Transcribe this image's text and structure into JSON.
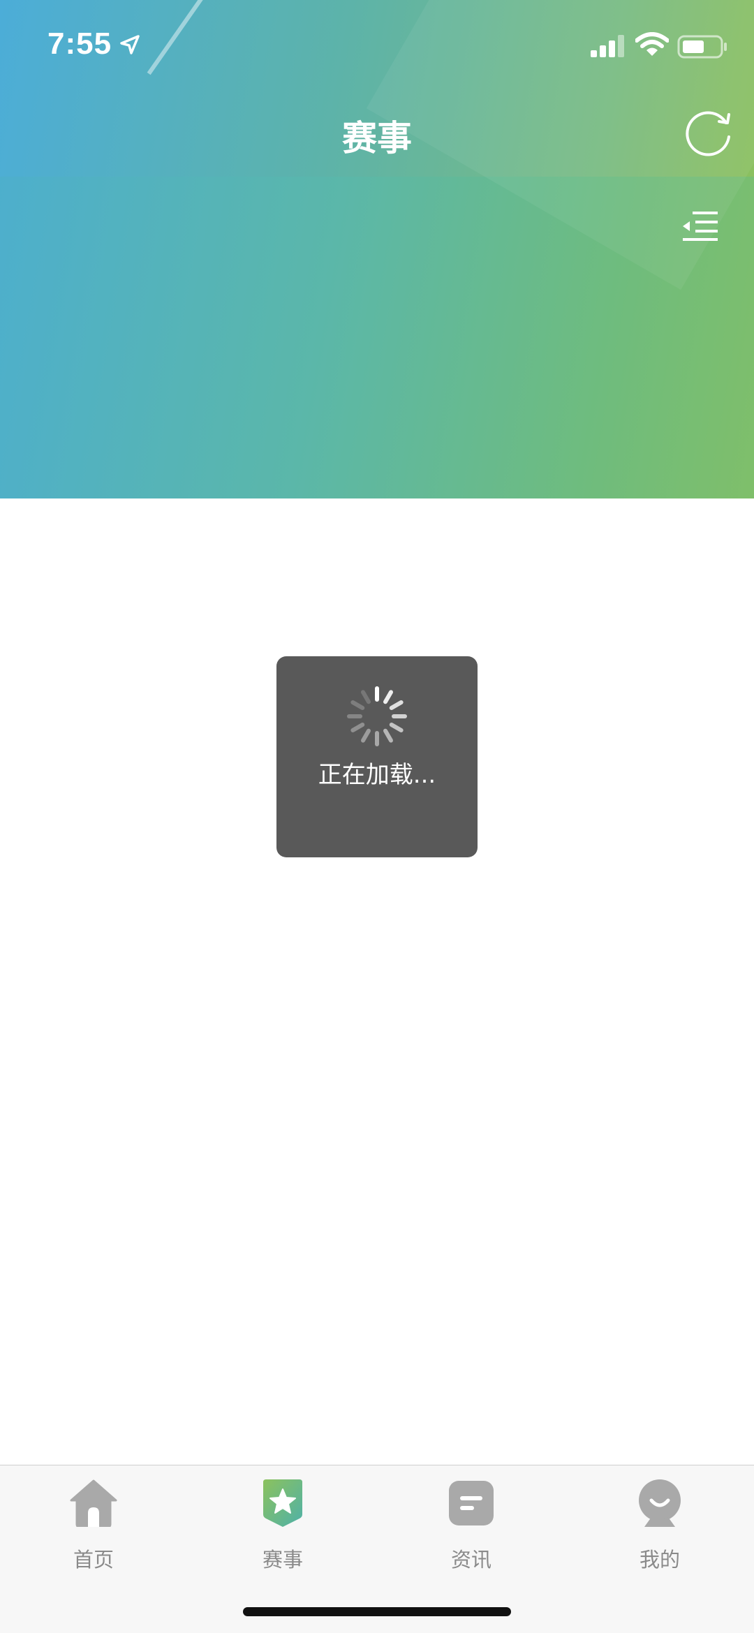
{
  "status_bar": {
    "time": "7:55"
  },
  "header": {
    "title": "赛事"
  },
  "loading": {
    "text": "正在加载..."
  },
  "tabbar": {
    "tabs": [
      {
        "label": "首页",
        "icon": "home-icon",
        "active": false
      },
      {
        "label": "赛事",
        "icon": "match-star-icon",
        "active": true
      },
      {
        "label": "资讯",
        "icon": "news-icon",
        "active": false
      },
      {
        "label": "我的",
        "icon": "profile-icon",
        "active": false
      }
    ]
  },
  "colors": {
    "gradient_start": "#4caed0",
    "gradient_end": "#8bc05f",
    "tab_inactive": "#8a8a8a",
    "loading_bg": "#595959"
  }
}
